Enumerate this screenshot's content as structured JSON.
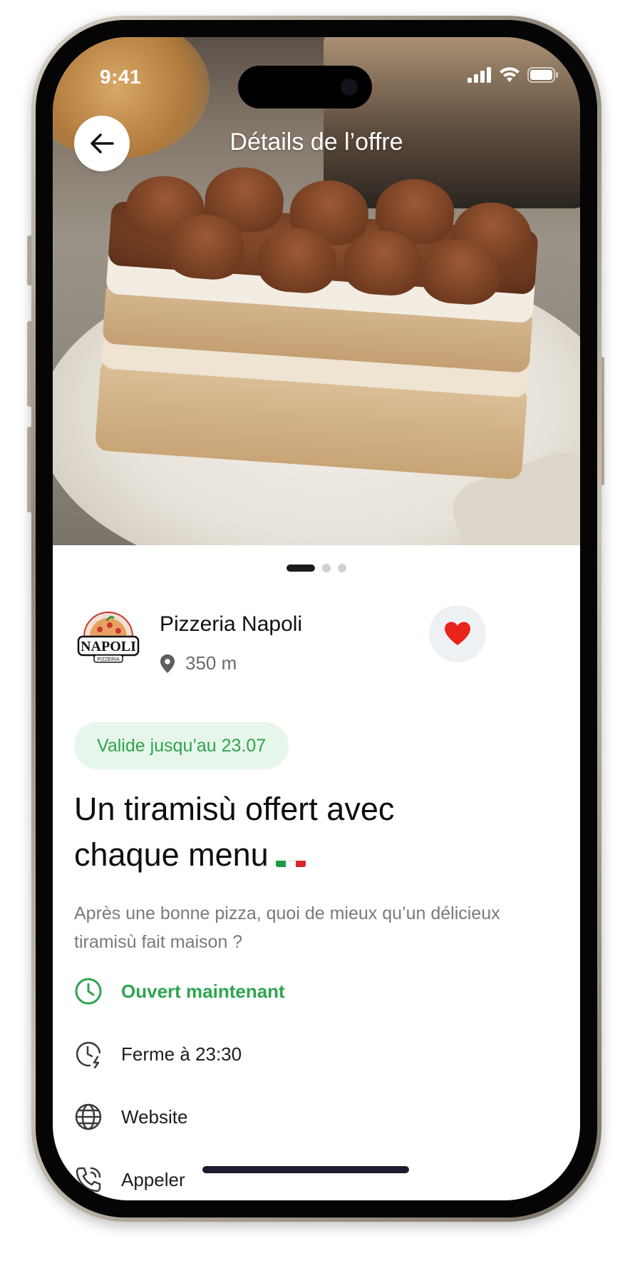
{
  "status_bar": {
    "time": "9:41"
  },
  "header": {
    "title": "Détails de l’offre",
    "back_icon": "arrow-left-icon"
  },
  "carousel": {
    "count": 3,
    "active_index": 0
  },
  "shop": {
    "name": "Pizzeria Napoli",
    "distance": "350 m",
    "logo_text": "NAPOLI",
    "logo_subtext": "PIZZERIA",
    "favorite": true
  },
  "offer": {
    "validity": "Valide jusqu’au 23.07",
    "title": "Un tiramisù offert avec chaque menu",
    "description": "Après une bonne pizza, quoi de mieux qu’un délicieux tiramisù fait maison ?"
  },
  "info": {
    "open_status": "Ouvert maintenant",
    "closing_time": "Ferme à 23:30",
    "website": "Website",
    "call": "Appeler"
  },
  "colors": {
    "accent_green": "#2ea44f",
    "badge_bg": "#e7f6ea",
    "heart_red": "#e8231a",
    "fav_button_bg": "#eef1f4"
  }
}
